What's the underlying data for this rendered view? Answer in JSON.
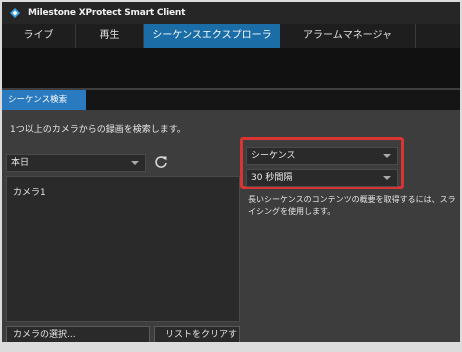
{
  "app": {
    "title": "Milestone XProtect Smart Client"
  },
  "tabs": [
    {
      "label": "ライブ"
    },
    {
      "label": "再生"
    },
    {
      "label": "シーケンスエクスプローラ",
      "active": true
    },
    {
      "label": "アラームマネージャ"
    }
  ],
  "subtab": {
    "label": "シーケンス検索"
  },
  "search": {
    "intro": "1つ以上のカメラからの録画を検索します。",
    "period": "本日",
    "cameras": [
      "カメラ1"
    ],
    "select_camera_label": "カメラの選択...",
    "clear_list_label": "リストをクリアする"
  },
  "options": {
    "type": "シーケンス",
    "interval": "30 秒間隔",
    "help": "長いシーケンスのコンテンツの概要を取得するには、スライシングを使用します。"
  },
  "colors": {
    "accent": "#1b6da8",
    "highlight": "#d83434"
  },
  "icons": {
    "logo": "milestone-logo-icon",
    "refresh": "refresh-icon",
    "dropdown": "chevron-down-icon"
  }
}
